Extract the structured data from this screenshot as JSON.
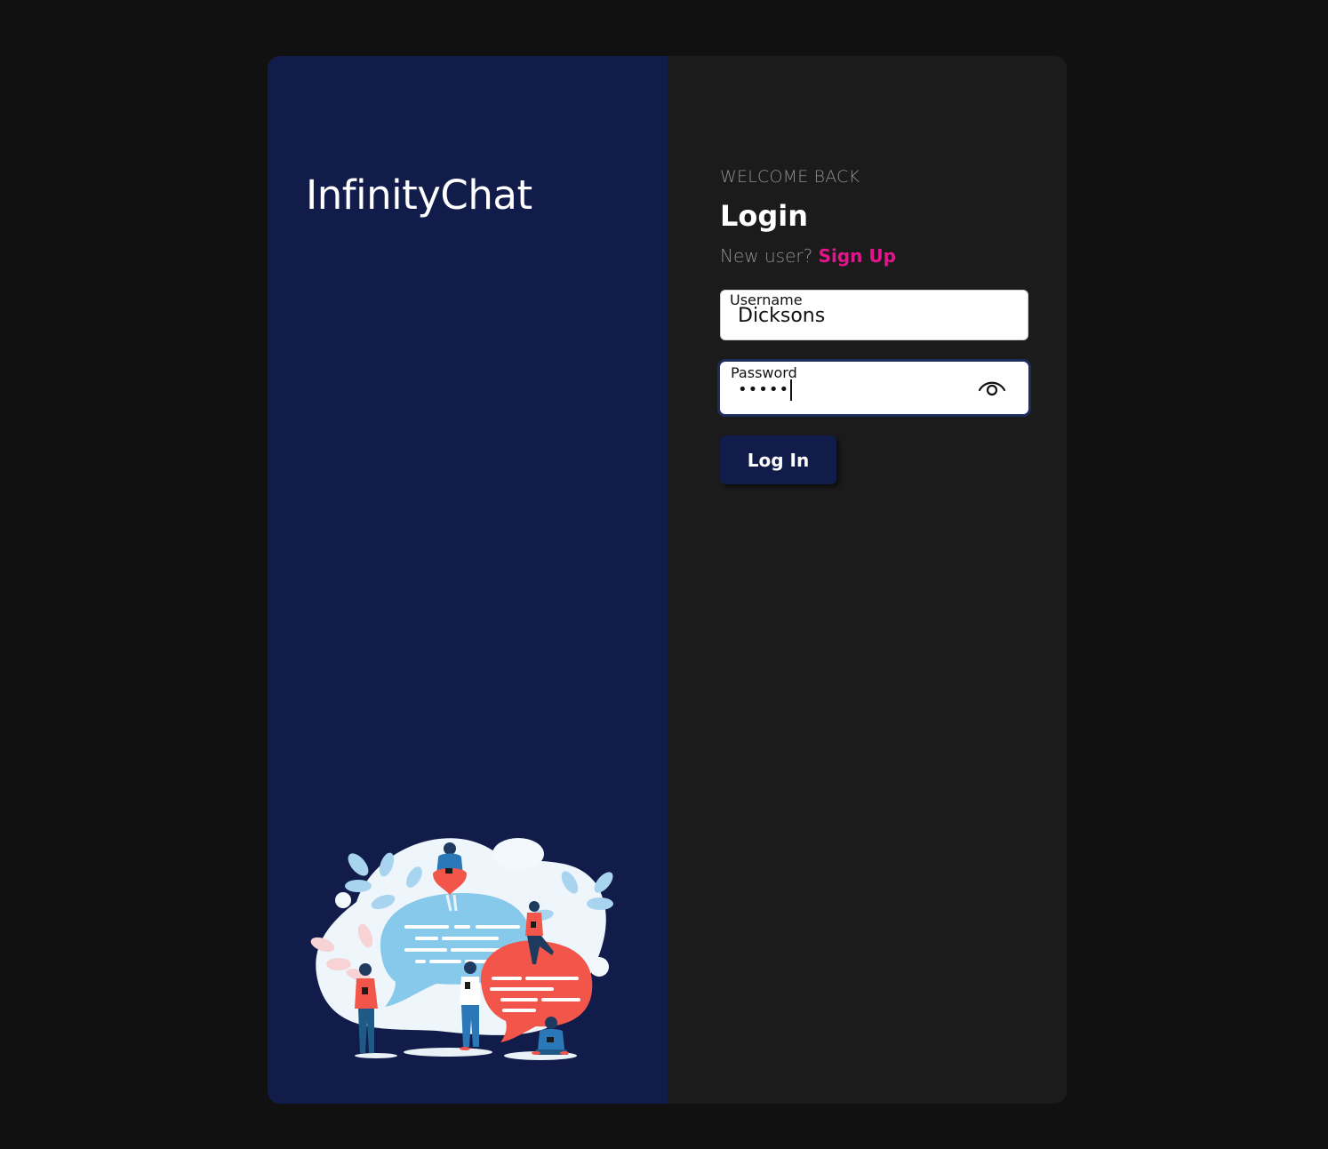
{
  "brand": {
    "name": "InfinityChat"
  },
  "login": {
    "welcome": "WELCOME BACK",
    "title": "Login",
    "new_user_prompt": "New user?",
    "signup_link": "Sign Up",
    "username": {
      "label": "Username",
      "value": "Dicksons"
    },
    "password": {
      "label": "Password",
      "masked_value": "•••••",
      "toggle_icon": "eye-icon"
    },
    "submit_label": "Log In"
  },
  "colors": {
    "background": "#111111",
    "left_panel": "#111c4a",
    "right_panel": "#1b1b1b",
    "accent": "#e4158c",
    "button": "#111c4a"
  }
}
